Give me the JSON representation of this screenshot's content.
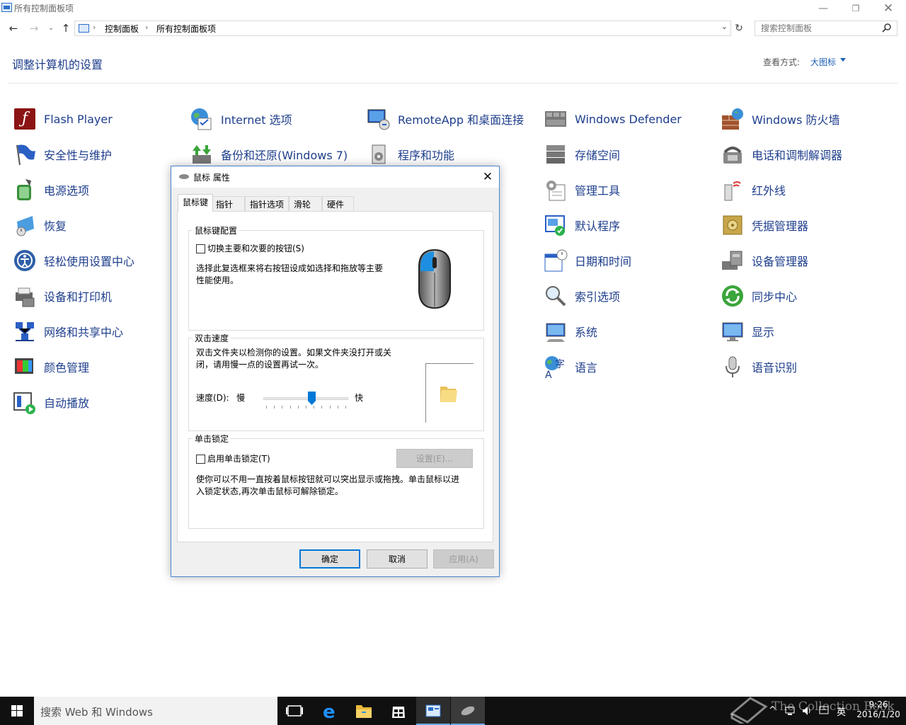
{
  "window": {
    "title": "所有控制面板项"
  },
  "address": {
    "crumbs": [
      "控制面板",
      "所有控制面板项"
    ]
  },
  "search": {
    "placeholder": "搜索控制面板"
  },
  "header": {
    "title": "调整计算机的设置",
    "view_label": "查看方式:",
    "view_value": "大图标"
  },
  "items": [
    {
      "label": "Flash Player",
      "icon": "flash-icon"
    },
    {
      "label": "安全性与维护",
      "icon": "flag-icon"
    },
    {
      "label": "电源选项",
      "icon": "power-icon"
    },
    {
      "label": "恢复",
      "icon": "recovery-icon"
    },
    {
      "label": "轻松使用设置中心",
      "icon": "ease-of-access-icon"
    },
    {
      "label": "设备和打印机",
      "icon": "printer-icon"
    },
    {
      "label": "网络和共享中心",
      "icon": "network-icon"
    },
    {
      "label": "颜色管理",
      "icon": "color-icon"
    },
    {
      "label": "自动播放",
      "icon": "autoplay-icon"
    },
    {
      "label": "Internet 选项",
      "icon": "globe-icon"
    },
    {
      "label": "备份和还原(Windows 7)",
      "icon": "backup-icon"
    },
    {
      "label": "RemoteApp 和桌面连接",
      "icon": "remoteapp-icon"
    },
    {
      "label": "程序和功能",
      "icon": "programs-icon"
    },
    {
      "label": "Windows Defender",
      "icon": "defender-icon"
    },
    {
      "label": "存储空间",
      "icon": "storage-icon"
    },
    {
      "label": "管理工具",
      "icon": "tools-icon"
    },
    {
      "label": "默认程序",
      "icon": "default-programs-icon"
    },
    {
      "label": "日期和时间",
      "icon": "calendar-icon"
    },
    {
      "label": "索引选项",
      "icon": "index-icon"
    },
    {
      "label": "系统",
      "icon": "system-icon"
    },
    {
      "label": "语言",
      "icon": "language-icon"
    },
    {
      "label": "Windows 防火墙",
      "icon": "firewall-icon"
    },
    {
      "label": "电话和调制解调器",
      "icon": "phone-icon"
    },
    {
      "label": "红外线",
      "icon": "infrared-icon"
    },
    {
      "label": "凭据管理器",
      "icon": "credential-icon"
    },
    {
      "label": "设备管理器",
      "icon": "device-manager-icon"
    },
    {
      "label": "同步中心",
      "icon": "sync-icon"
    },
    {
      "label": "显示",
      "icon": "display-icon"
    },
    {
      "label": "语音识别",
      "icon": "microphone-icon"
    }
  ],
  "dialog": {
    "title": "鼠标 属性",
    "tabs": [
      "鼠标键",
      "指针",
      "指针选项",
      "滑轮",
      "硬件"
    ],
    "button_config": {
      "group_label": "鼠标键配置",
      "checkbox_label": "切换主要和次要的按钮(S)",
      "checked": false,
      "description": [
        "选择此复选框来将右按钮设成如选择和拖放等主要",
        "性能使用。"
      ]
    },
    "double_click": {
      "group_label": "双击速度",
      "description": [
        "双击文件夹以检测你的设置。如果文件夹没打开或关",
        "闭，请用慢一点的设置再试一次。"
      ],
      "speed_label": "速度(D):",
      "slow_label": "慢",
      "fast_label": "快",
      "speed_value": 0.58
    },
    "click_lock": {
      "group_label": "单击锁定",
      "checkbox_label": "启用单击锁定(T)",
      "checked": false,
      "settings_button": "设置(E)...",
      "description": [
        "使你可以不用一直按着鼠标按钮就可以突出显示或拖拽。单击鼠标以进",
        "入锁定状态,再次单击鼠标可解除锁定。"
      ]
    },
    "buttons": {
      "ok": "确定",
      "cancel": "取消",
      "apply": "应用(A)"
    }
  },
  "taskbar": {
    "search_placeholder": "搜索 Web 和 Windows",
    "time": "9:26",
    "date": "2016/1/20",
    "ime": "英"
  },
  "watermark": "The Collection Book",
  "colors": {
    "link": "#1e3e8c",
    "accent": "#0078d7",
    "taskbar": "#101010"
  }
}
